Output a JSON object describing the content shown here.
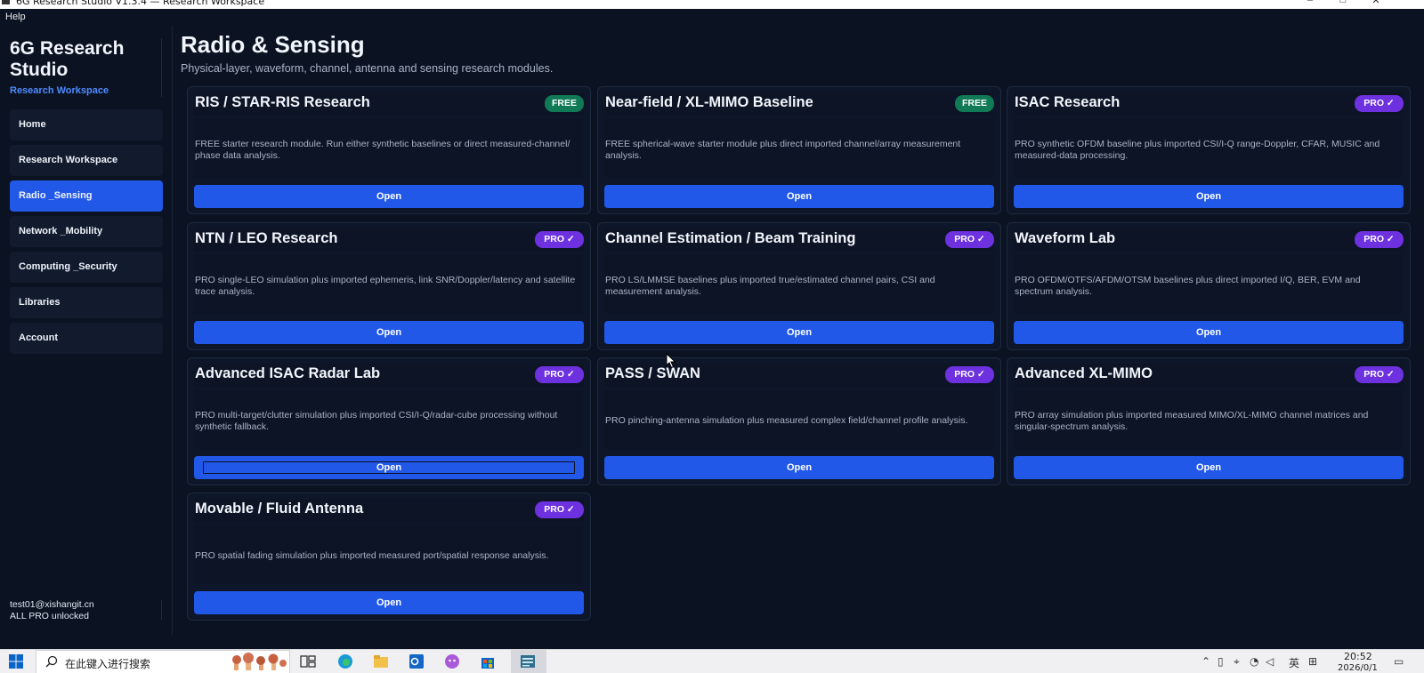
{
  "window": {
    "title": "6G Research Studio V1.3.4 — Research Workspace",
    "minimize_glyph": "–",
    "maximize_glyph": "□",
    "close_glyph": "✕"
  },
  "menu": {
    "help": "Help"
  },
  "sidebar": {
    "brand_title": "6G Research Studio",
    "brand_subtitle": "Research Workspace",
    "items": [
      {
        "label": "Home",
        "active": false
      },
      {
        "label": "Research Workspace",
        "active": false
      },
      {
        "label": "Radio _Sensing",
        "active": true
      },
      {
        "label": "Network _Mobility",
        "active": false
      },
      {
        "label": "Computing _Security",
        "active": false
      },
      {
        "label": "Libraries",
        "active": false
      },
      {
        "label": "Account",
        "active": false
      }
    ],
    "user_email": "test01@xishangit.cn",
    "user_status": "ALL PRO unlocked"
  },
  "page": {
    "title": "Radio & Sensing",
    "subtitle": "Physical-layer, waveform, channel, antenna and sensing research modules."
  },
  "cards": [
    {
      "title": "RIS / STAR-RIS Research",
      "badge": "FREE",
      "desc": "FREE starter research module. Run either synthetic baselines or direct measured-channel/ phase data analysis.",
      "button": "Open"
    },
    {
      "title": "Near-field / XL-MIMO Baseline",
      "badge": "FREE",
      "desc": "FREE spherical-wave starter module plus direct imported channel/array measurement analysis.",
      "button": "Open"
    },
    {
      "title": "ISAC Research",
      "badge": "PRO ✓",
      "desc": "PRO synthetic OFDM baseline plus imported CSI/I-Q range-Doppler, CFAR, MUSIC and measured-data processing.",
      "button": "Open"
    },
    {
      "title": "NTN / LEO Research",
      "badge": "PRO ✓",
      "desc": "PRO single-LEO simulation plus imported ephemeris, link SNR/Doppler/latency and satellite trace analysis.",
      "button": "Open"
    },
    {
      "title": "Channel Estimation / Beam Training",
      "badge": "PRO ✓",
      "desc": "PRO LS/LMMSE baselines plus imported true/estimated channel pairs, CSI and measurement analysis.",
      "button": "Open"
    },
    {
      "title": "Waveform Lab",
      "badge": "PRO ✓",
      "desc": "PRO OFDM/OTFS/AFDM/OTSM baselines plus direct imported I/Q, BER, EVM and spectrum analysis.",
      "button": "Open"
    },
    {
      "title": "Advanced ISAC Radar Lab",
      "badge": "PRO ✓",
      "desc": "PRO multi-target/clutter simulation plus imported CSI/I-Q/radar-cube processing without synthetic fallback.",
      "button": "Open"
    },
    {
      "title": "PASS / SWAN",
      "badge": "PRO ✓",
      "desc": "PRO pinching-antenna simulation plus measured complex field/channel profile analysis.",
      "button": "Open"
    },
    {
      "title": "Advanced XL-MIMO",
      "badge": "PRO ✓",
      "desc": "PRO array simulation plus imported measured MIMO/XL-MIMO channel matrices and singular-spectrum analysis.",
      "button": "Open"
    },
    {
      "title": "Movable / Fluid Antenna",
      "badge": "PRO ✓",
      "desc": "PRO spatial fading simulation plus imported measured port/spatial response analysis.",
      "button": "Open"
    }
  ],
  "taskbar": {
    "search_placeholder": "在此键入进行搜索",
    "ime": "英",
    "time": "20:52",
    "date": "2026/0/1"
  },
  "colors": {
    "background": "#0b1323",
    "accent": "#2158e8",
    "free_badge": "#0f7a55",
    "pro_badge": "#6d31e0"
  }
}
